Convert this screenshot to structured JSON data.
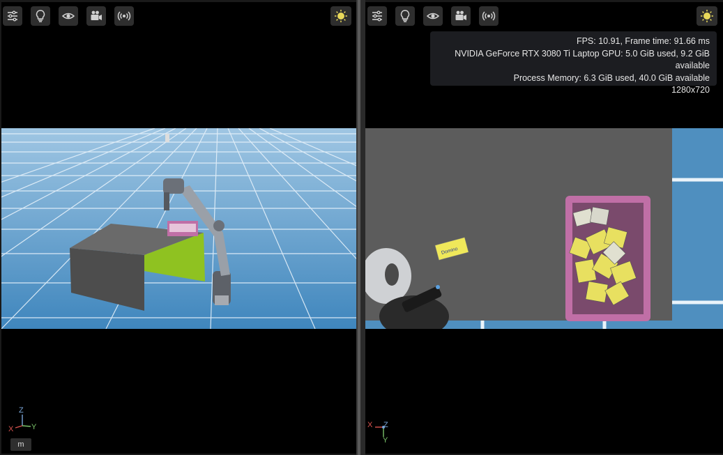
{
  "viewport_left": {
    "toolbar": [
      "settings-icon",
      "lightbulb-icon",
      "eye-icon",
      "camera-icon",
      "broadcast-icon"
    ],
    "unit_label": "m",
    "axes": {
      "z": "Z",
      "x": "X",
      "y": "Y"
    }
  },
  "viewport_right": {
    "toolbar": [
      "settings-icon",
      "lightbulb-icon",
      "eye-icon",
      "camera-icon",
      "broadcast-icon"
    ],
    "stats": {
      "fps_line": "FPS: 10.91, Frame time: 91.66 ms",
      "gpu_line": "NVIDIA GeForce RTX 3080 Ti Laptop GPU: 5.0 GiB used, 9.2 GiB available",
      "process_line": "Process Memory: 6.3 GiB used, 40.0 GiB available",
      "resolution": "1280x720"
    },
    "axes": {
      "x": "X",
      "z": "Z",
      "y": "Y"
    },
    "box_label": "Domino"
  },
  "colors": {
    "toolbar_bg": "#2e2e2e",
    "icon": "#d0d0d0",
    "sun": "#e8d85a",
    "floor": "#4f8fbf",
    "table": "#5a5a5a",
    "green_panel": "#8fc221",
    "crate": "#c06fa6",
    "axis_x": "#d9534f",
    "axis_y": "#7ac36a",
    "axis_z": "#7aa6d9"
  }
}
